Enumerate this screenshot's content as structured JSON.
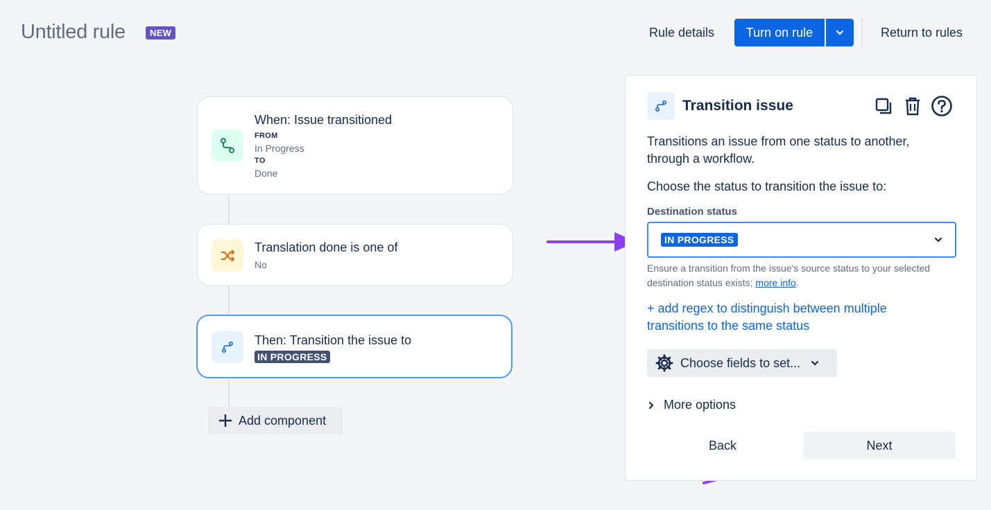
{
  "header": {
    "title": "Untitled rule",
    "badge": "NEW",
    "rule_details": "Rule details",
    "turn_on_rule": "Turn on rule",
    "return_to_rules": "Return to rules"
  },
  "flow": {
    "trigger": {
      "title": "When: Issue transitioned",
      "from_label": "FROM",
      "from_value": "In Progress",
      "to_label": "TO",
      "to_value": "Done",
      "icon": "transition-icon"
    },
    "condition": {
      "title": "Translation done is one of",
      "value": "No",
      "icon": "shuffle-icon"
    },
    "action": {
      "title": "Then: Transition the issue to",
      "status": "IN PROGRESS",
      "icon": "transition-icon"
    },
    "add_component": "Add component"
  },
  "panel": {
    "title": "Transition issue",
    "description": "Transitions an issue from one status to another, through a workflow.",
    "choose_prompt": "Choose the status to transition the issue to:",
    "destination_label": "Destination status",
    "destination_value": "IN PROGRESS",
    "hint_text": "Ensure a transition from the issue's source status to your selected destination status exists; ",
    "hint_link": "more info",
    "hint_end": ".",
    "regex_link": "+ add regex to distinguish between multiple transitions to the same status",
    "fields_button": "Choose fields to set...",
    "more_options": "More options",
    "back": "Back",
    "next": "Next"
  },
  "colors": {
    "primary": "#0c66e4",
    "badge_purple": "#6554c0",
    "annotation_arrow": "#8b3ff0",
    "trigger_icon_bg": "#dcfff1",
    "condition_icon_bg": "#fff7d6"
  }
}
